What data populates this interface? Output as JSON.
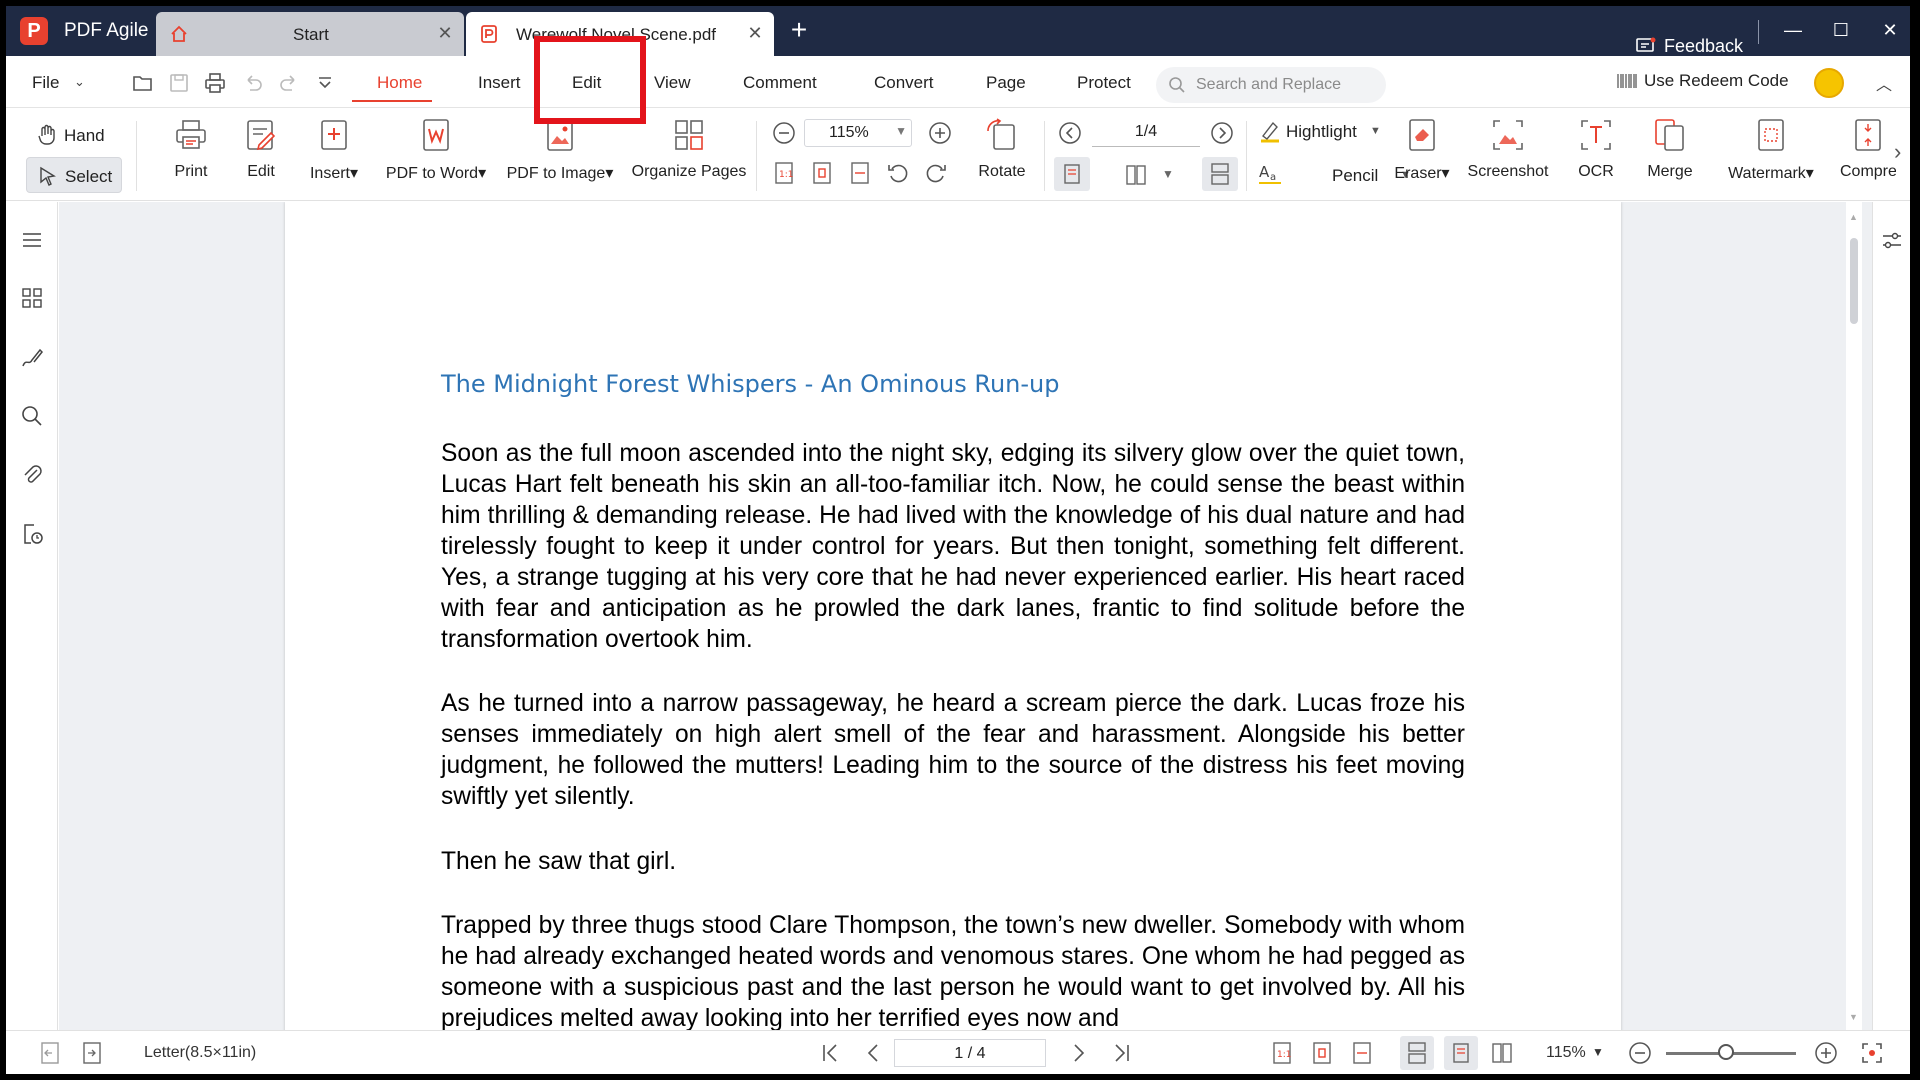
{
  "app": {
    "name": "PDF Agile",
    "logo_letter": "P",
    "accent": "#e8412f",
    "titlebar_color": "#1f2a44"
  },
  "tabs": [
    {
      "label": "Start",
      "icon": "home-icon"
    },
    {
      "label": "Werewolf Novel Scene.pdf",
      "icon": "pdf-icon"
    }
  ],
  "titlebar": {
    "feedback_label": "Feedback"
  },
  "menu": {
    "file_label": "File",
    "tabs": [
      "Home",
      "Insert",
      "Edit",
      "View",
      "Comment",
      "Convert",
      "Page",
      "Protect"
    ],
    "active_tab": "Home",
    "search_placeholder": "Search and Replace",
    "redeem_label": "Use Redeem Code"
  },
  "ribbon": {
    "hand_label": "Hand",
    "select_label": "Select",
    "tools": {
      "print": "Print",
      "edit": "Edit",
      "insert": "Insert▾",
      "pdf_to_word": "PDF to Word▾",
      "pdf_to_image": "PDF to Image▾",
      "organize": "Organize Pages",
      "rotate": "Rotate",
      "eraser": "Eraser▾",
      "screenshot": "Screenshot",
      "ocr": "OCR",
      "merge": "Merge",
      "watermark": "Watermark▾",
      "compress": "Compre"
    },
    "zoom_value": "115%",
    "page_value": "1/4",
    "highlight_label": "Hightlight",
    "pencil_label": "Pencil"
  },
  "document": {
    "title": "The Midnight Forest Whispers - An Ominous Run-up",
    "paragraphs": [
      "Soon as the full moon ascended into the night sky, edging its silvery glow over the quiet town, Lucas Hart felt beneath his skin an all-too-familiar itch. Now, he could sense the beast within him thrilling & demanding release. He had lived with the knowledge of his dual nature and had tirelessly fought to keep it under control for years. But then tonight, something felt different. Yes, a strange tugging at his very core that he had never experienced earlier. His heart raced with fear and anticipation as he prowled the dark lanes, frantic to find solitude before the transformation overtook him.",
      "As he turned into a narrow passageway, he heard a scream pierce the dark. Lucas froze his senses immediately on high alert smell of the fear and harassment. Alongside his better judgment, he followed the mutters! Leading him to the source of the distress his feet moving swiftly yet silently.",
      "Then he saw that girl.",
      "Trapped by three thugs stood Clare Thompson, the town’s new dweller. Somebody with whom he had already exchanged heated words and venomous stares. One whom he had pegged as someone with a suspicious past and the last person he would want to get involved by. All his prejudices melted away looking into her terrified eyes now and"
    ]
  },
  "statusbar": {
    "page_size": "Letter(8.5×11in)",
    "page_indicator": "1 / 4",
    "zoom": "115%",
    "zoom_level_fraction": 0.46
  }
}
